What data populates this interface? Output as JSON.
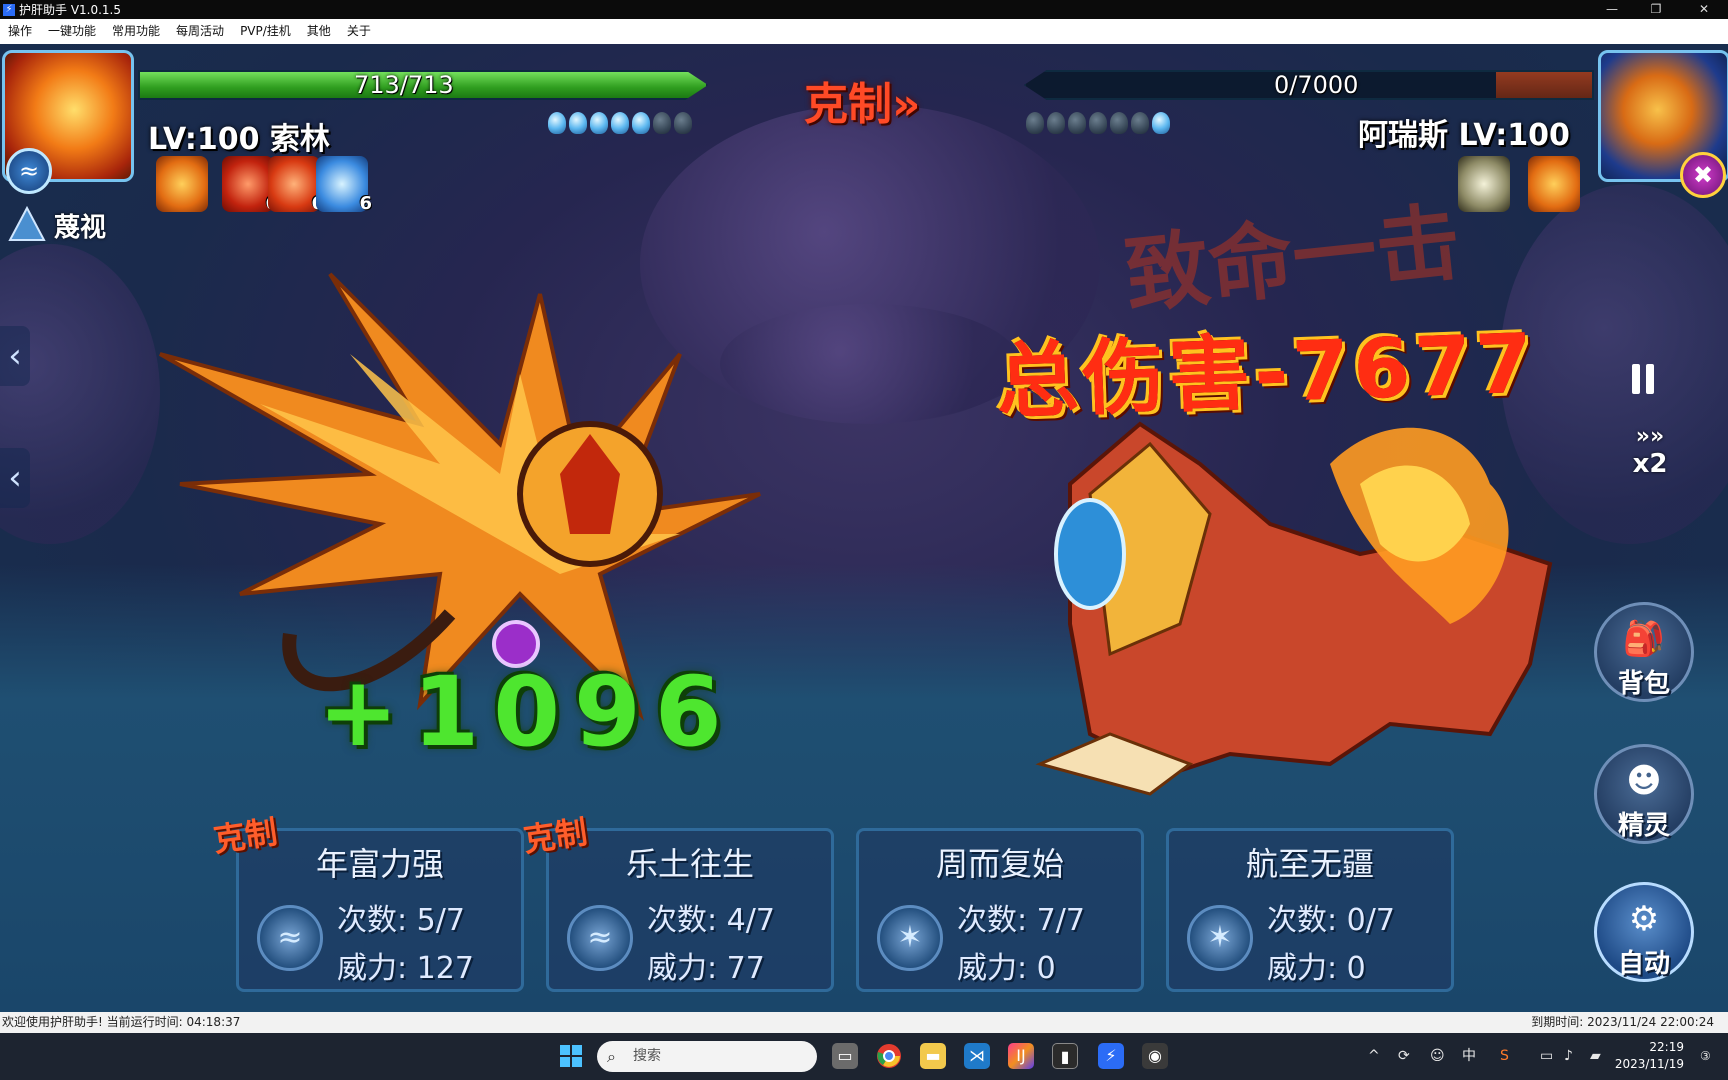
{
  "window": {
    "title": "护肝助手 V1.0.1.5"
  },
  "menu": [
    "操作",
    "一键功能",
    "常用功能",
    "每周活动",
    "PVP/挂机",
    "其他",
    "关于"
  ],
  "battle": {
    "counter_banner": "克制»",
    "player": {
      "hp_text": "713/713",
      "hp_fraction": 1.0,
      "level_name": "LV:100 索林",
      "buff_counts": [
        "6",
        "6",
        "6"
      ]
    },
    "enemy": {
      "hp_text": "0/7000",
      "hp_fraction": 0.0,
      "level_name": "阿瑞斯 LV:100"
    },
    "scout_label": "蔑视",
    "crit_text": "致命一击",
    "damage_text": "总伤害-7677",
    "heal_text": "+1096",
    "speed_label": "x2"
  },
  "side_buttons": {
    "bag": "背包",
    "spirit": "精灵",
    "auto": "自动"
  },
  "skills": [
    {
      "name": "年富力强",
      "uses": "次数: 5/7",
      "power": "威力: 127",
      "counter_tag": "克制"
    },
    {
      "name": "乐土往生",
      "uses": "次数: 4/7",
      "power": "威力: 77",
      "counter_tag": "克制"
    },
    {
      "name": "周而复始",
      "uses": "次数: 7/7",
      "power": "威力: 0",
      "counter_tag": ""
    },
    {
      "name": "航至无疆",
      "uses": "次数: 0/7",
      "power": "威力: 0",
      "counter_tag": ""
    }
  ],
  "statusbar": {
    "left": "欢迎使用护肝助手! 当前运行时间: 04:18:37",
    "right": "到期时间: 2023/11/24 22:00:24"
  },
  "taskbar": {
    "search_placeholder": "搜索",
    "ime": "中",
    "time": "22:19",
    "date": "2023/11/19"
  },
  "icons": {
    "start": "windows-start-icon",
    "search": "search-icon",
    "browser": "chrome-icon",
    "files": "folder-icon",
    "vscode": "vscode-icon",
    "idea": "intellij-icon",
    "terminal": "terminal-icon",
    "helper": "lightning-app-icon"
  }
}
